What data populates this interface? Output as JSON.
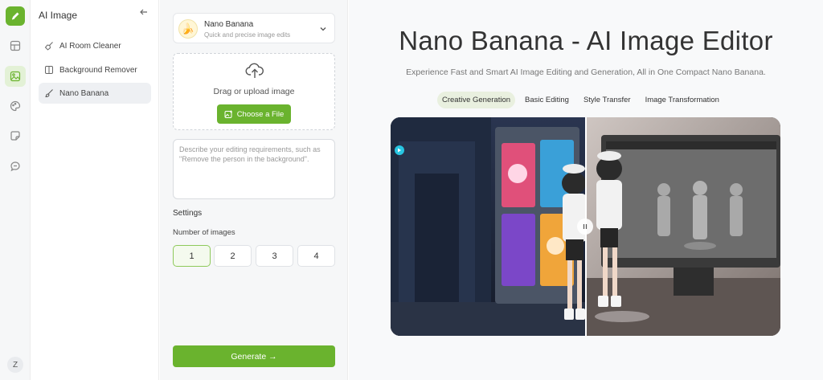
{
  "colors": {
    "accent": "#6ab32e",
    "accent_light": "#e3f1d6"
  },
  "rail": {
    "icons": [
      "layout-icon",
      "image-icon",
      "palette-icon",
      "sticker-icon",
      "chat-icon"
    ],
    "avatar_initial": "Z"
  },
  "sidebar": {
    "title": "AI Image",
    "items": [
      {
        "label": "AI Room Cleaner",
        "icon": "broom-icon"
      },
      {
        "label": "Background Remover",
        "icon": "cutout-icon"
      },
      {
        "label": "Nano Banana",
        "icon": "brush-icon"
      }
    ]
  },
  "form": {
    "model": {
      "emoji": "🍌",
      "name": "Nano Banana",
      "subtitle": "Quick and precise image edits"
    },
    "upload": {
      "text": "Drag or upload image",
      "button": "Choose a File"
    },
    "prompt": {
      "placeholder": "Describe your editing requirements, such as \"Remove the person in the background\".",
      "value": ""
    },
    "settings_label": "Settings",
    "num_images_label": "Number of images",
    "num_options": [
      "1",
      "2",
      "3",
      "4"
    ],
    "num_selected": "1",
    "generate_label": "Generate →"
  },
  "main": {
    "title": "Nano Banana - AI Image Editor",
    "subtitle": "Experience Fast and Smart AI Image Editing and Generation, All in One Compact Nano Banana.",
    "tabs": [
      "Creative Generation",
      "Basic Editing",
      "Style Transfer",
      "Image Transformation"
    ],
    "active_tab": "Creative Generation",
    "handle_glyph": "||"
  }
}
